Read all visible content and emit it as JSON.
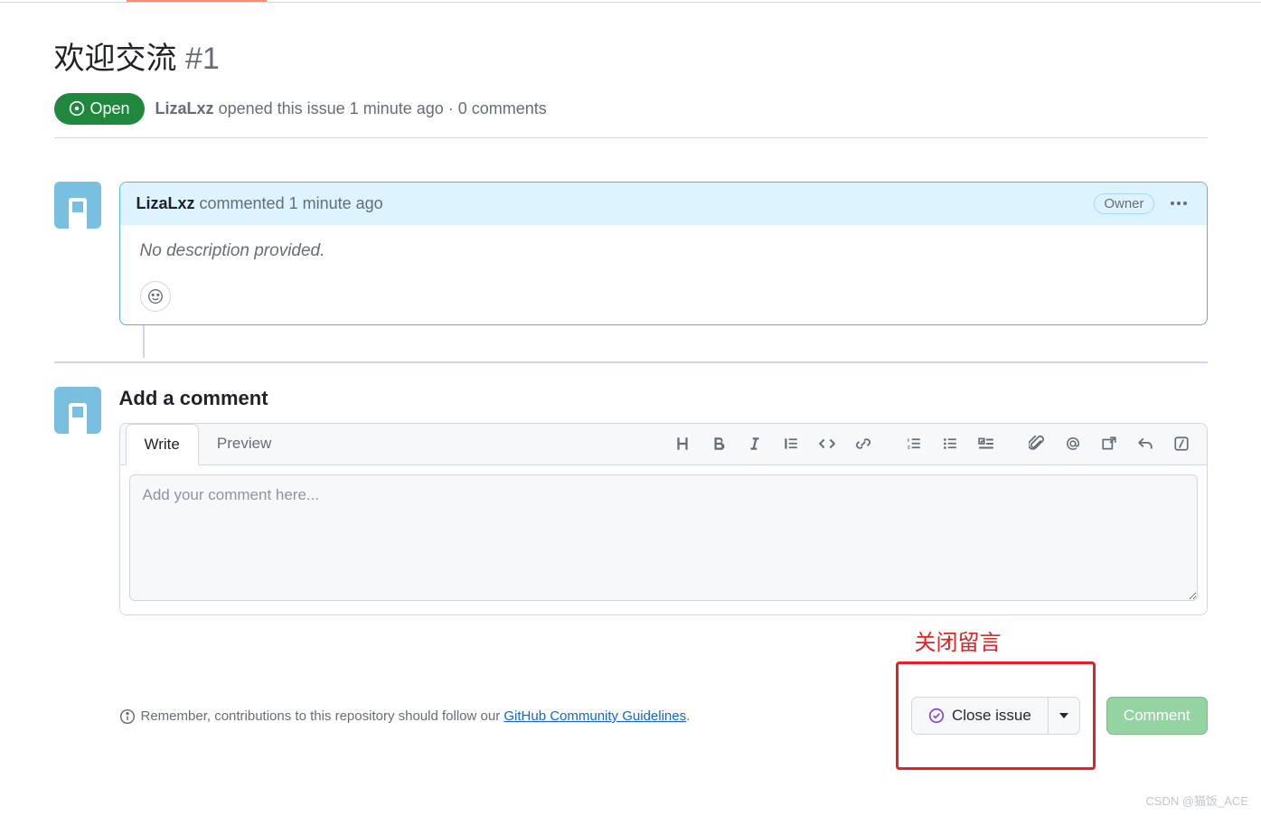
{
  "issue": {
    "title": "欢迎交流",
    "number": "#1",
    "state": "Open",
    "author": "LizaLxz",
    "openedText": "opened this issue 1 minute ago · 0 comments"
  },
  "comment": {
    "author": "LizaLxz",
    "action": "commented 1 minute ago",
    "ownerBadge": "Owner",
    "body": "No description provided."
  },
  "addComment": {
    "title": "Add a comment",
    "tabs": {
      "write": "Write",
      "preview": "Preview"
    },
    "placeholder": "Add your comment here..."
  },
  "annotation": "关闭留言",
  "actions": {
    "close": "Close issue",
    "comment": "Comment"
  },
  "footer": {
    "pre": "Remember, contributions to this repository should follow our ",
    "link": "GitHub Community Guidelines",
    "post": "."
  },
  "watermark": "CSDN @猫饭_ACE"
}
